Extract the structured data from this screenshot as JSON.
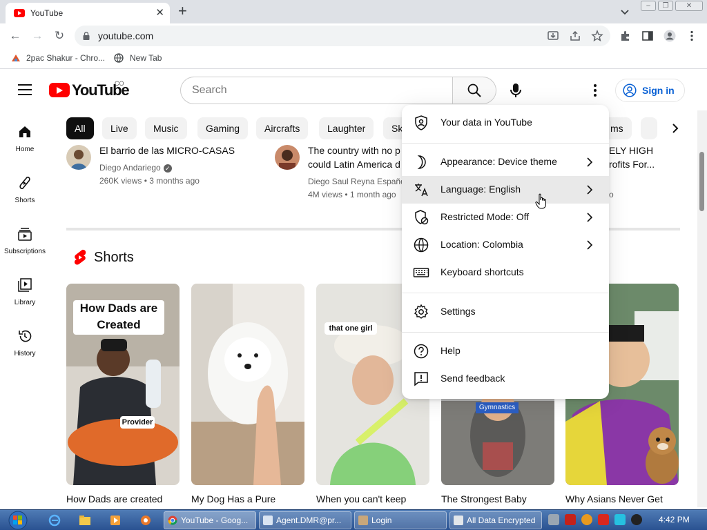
{
  "browser": {
    "tab_title": "YouTube",
    "url": "youtube.com",
    "bookmarks": [
      {
        "label": "2pac Shakur - Chro..."
      },
      {
        "label": "New Tab"
      }
    ]
  },
  "masthead": {
    "logo_text": "YouTube",
    "country_code": "CO",
    "search_placeholder": "Search",
    "signin_label": "Sign in"
  },
  "guide": [
    {
      "label": "Home",
      "icon": "home-icon"
    },
    {
      "label": "Shorts",
      "icon": "shorts-icon"
    },
    {
      "label": "Subscriptions",
      "icon": "subscriptions-icon"
    },
    {
      "label": "Library",
      "icon": "library-icon"
    },
    {
      "label": "History",
      "icon": "history-icon"
    }
  ],
  "chips": [
    "All",
    "Live",
    "Music",
    "Gaming",
    "Aircrafts",
    "Laughter",
    "Sk",
    "ms"
  ],
  "videos": [
    {
      "title": "El barrio de las MICRO-CASAS",
      "channel": "Diego Andariego",
      "meta": "260K views • 3 months ago"
    },
    {
      "title_line1": "The country with no p",
      "title_line2": "could Latin America d",
      "channel": "Diego Saul Reyna Español",
      "meta": "4M views • 1 month ago"
    },
    {
      "title_line1": "ELY HIGH",
      "title_line2": "rofits For...",
      "meta": "o"
    }
  ],
  "shorts": {
    "heading": "Shorts",
    "items": [
      {
        "title": "How Dads are created",
        "overlay_line1": "How Dads are",
        "overlay_line2": "Created",
        "sub_overlay": "Provider"
      },
      {
        "title": "My Dog Has a Pure"
      },
      {
        "title": "When you can't keep",
        "overlay_line1": "that one girl"
      },
      {
        "title": "The Strongest Baby",
        "overlay_line1": "Gymnastics"
      },
      {
        "title": "Why Asians Never Get"
      }
    ]
  },
  "menu": {
    "items": [
      {
        "label": "Your data in YouTube",
        "icon": "shield-person-icon",
        "chevron": false
      },
      {
        "label": "Appearance: Device theme",
        "icon": "moon-icon",
        "chevron": true
      },
      {
        "label": "Language: English",
        "icon": "translate-icon",
        "chevron": true
      },
      {
        "label": "Restricted Mode: Off",
        "icon": "restricted-mode-icon",
        "chevron": true
      },
      {
        "label": "Location: Colombia",
        "icon": "globe-icon",
        "chevron": true
      },
      {
        "label": "Keyboard shortcuts",
        "icon": "keyboard-icon",
        "chevron": false
      },
      {
        "label": "Settings",
        "icon": "gear-icon",
        "chevron": false
      },
      {
        "label": "Help",
        "icon": "help-icon",
        "chevron": false
      },
      {
        "label": "Send feedback",
        "icon": "feedback-icon",
        "chevron": false
      }
    ]
  },
  "taskbar": {
    "buttons": [
      {
        "label": "YouTube - Goog..."
      },
      {
        "label": "Agent.DMR@pr..."
      },
      {
        "label": "Login"
      },
      {
        "label": "All Data Encrypted"
      }
    ],
    "clock": "4:42 PM"
  },
  "colors": {
    "youtube_red": "#ff0000",
    "signin_blue": "#065fd4",
    "menu_hover": "#e9e9e9",
    "taskbar": "#3a64a3"
  }
}
